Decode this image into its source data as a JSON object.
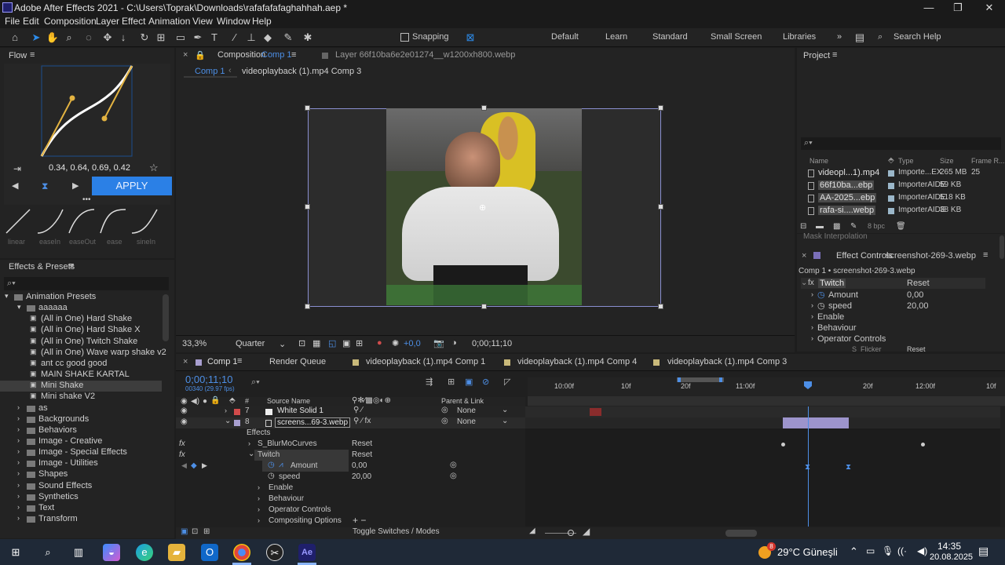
{
  "window": {
    "title": "Adobe After Effects 2021 - C:\\Users\\Toprak\\Downloads\\rafafafafaghahhah.aep *",
    "minimize": "—",
    "maximize": "❐",
    "close": "✕"
  },
  "menu": [
    "File",
    "Edit",
    "Composition",
    "Layer",
    "Effect",
    "Animation",
    "View",
    "Window",
    "Help"
  ],
  "toolbar": {
    "snapping": "Snapping",
    "workspaces": [
      "Default",
      "Learn",
      "Standard",
      "Small Screen",
      "Libraries"
    ],
    "more": "»",
    "search": "Search Help"
  },
  "flow": {
    "title": "Flow",
    "values": "0.34, 0.64, 0.69, 0.42",
    "apply": "APPLY",
    "presets": [
      "linear",
      "easeIn",
      "easeOut",
      "ease",
      "sineIn"
    ]
  },
  "effects_presets": {
    "title": "Effects & Presets",
    "search_placeholder": "⌕▾",
    "items": [
      {
        "label": "Animation Presets",
        "depth": 0,
        "type": "folder",
        "open": true
      },
      {
        "label": "aaaaaa",
        "depth": 1,
        "type": "folder",
        "open": true
      },
      {
        "label": "(All in One) Hard Shake",
        "depth": 2,
        "type": "preset"
      },
      {
        "label": "(All in One) Hard Shake X",
        "depth": 2,
        "type": "preset"
      },
      {
        "label": "(All in One) Twitch Shake",
        "depth": 2,
        "type": "preset"
      },
      {
        "label": "(All in One) Wave warp shake v2",
        "depth": 2,
        "type": "preset"
      },
      {
        "label": "ant cc good good",
        "depth": 2,
        "type": "preset"
      },
      {
        "label": "MAIN SHAKE KARTAL",
        "depth": 2,
        "type": "preset"
      },
      {
        "label": "Mini Shake",
        "depth": 2,
        "type": "preset",
        "selected": true
      },
      {
        "label": "Mini shake V2",
        "depth": 2,
        "type": "preset"
      },
      {
        "label": "as",
        "depth": 1,
        "type": "folder"
      },
      {
        "label": "Backgrounds",
        "depth": 1,
        "type": "folder"
      },
      {
        "label": "Behaviors",
        "depth": 1,
        "type": "folder"
      },
      {
        "label": "Image - Creative",
        "depth": 1,
        "type": "folder"
      },
      {
        "label": "Image - Special Effects",
        "depth": 1,
        "type": "folder"
      },
      {
        "label": "Image - Utilities",
        "depth": 1,
        "type": "folder"
      },
      {
        "label": "Shapes",
        "depth": 1,
        "type": "folder"
      },
      {
        "label": "Sound Effects",
        "depth": 1,
        "type": "folder"
      },
      {
        "label": "Synthetics",
        "depth": 1,
        "type": "folder"
      },
      {
        "label": "Text",
        "depth": 1,
        "type": "folder"
      },
      {
        "label": "Transform",
        "depth": 1,
        "type": "folder"
      }
    ]
  },
  "viewer": {
    "tab_comp": "Composition",
    "tab_comp_name": "Comp 1",
    "tab_layer": "Layer  66f10ba6e2e01274__w1200xh800.webp",
    "breadcrumb_1": "Comp 1",
    "breadcrumb_2": "videoplayback (1).mp4 Comp 3",
    "zoom": "33,3%",
    "resolution": "Quarter",
    "exposure": "+0,0",
    "timecode": "0;00;11;10"
  },
  "project": {
    "title": "Project",
    "search": "⌕▾",
    "columns": [
      "Name",
      "Type",
      "Size",
      "Frame R..."
    ],
    "rows": [
      {
        "name": "videopl...1).mp4",
        "type": "Importe...EX",
        "size": "265 MB",
        "fr": "25"
      },
      {
        "name": "66f10ba...ebp",
        "type": "ImporterAIDE",
        "size": "59 KB",
        "fr": ""
      },
      {
        "name": "AA-2025...ebp",
        "type": "ImporterAIDE",
        "size": "518 KB",
        "fr": ""
      },
      {
        "name": "rafa-si....webp",
        "type": "ImporterAIDE",
        "size": "38 KB",
        "fr": ""
      }
    ],
    "bpc": "8 bpc",
    "mask_interp": "Mask Interpolation"
  },
  "effect_controls": {
    "title": "Effect Controls",
    "layer": "screenshot-269-3.webp",
    "path": "Comp 1 • screenshot-269-3.webp",
    "effect": "Twitch",
    "reset": "Reset",
    "amount_label": "Amount",
    "amount": "0,00",
    "speed_label": "speed",
    "speed": "20,00",
    "groups": [
      "Enable",
      "Behaviour",
      "Operator Controls"
    ],
    "next": "S_Flicker"
  },
  "timeline": {
    "tabs": [
      "Comp 1",
      "Render Queue",
      "videoplayback (1).mp4 Comp 1",
      "videoplayback (1).mp4 Comp 4",
      "videoplayback (1).mp4 Comp 3"
    ],
    "timecode": "0;00;11;10",
    "sub_timecode": "00340 (29.97 fps)",
    "ruler": [
      "10:00f",
      "10f",
      "20f",
      "11:00f",
      "20f",
      "12:00f",
      "10f"
    ],
    "col_source": "Source Name",
    "col_parent": "Parent & Link",
    "col_num": "#",
    "layers": [
      {
        "num": "7",
        "name": "White Solid 1",
        "parent": "None",
        "color": "#d14b4b"
      },
      {
        "num": "8",
        "name": "screens...69-3.webp",
        "parent": "None",
        "color": "#a89fd0"
      }
    ],
    "props": {
      "effects": "Effects",
      "blur": "S_BlurMoCurves",
      "twitch": "Twitch",
      "reset": "Reset",
      "amount": "Amount",
      "amount_val": "0,00",
      "speed": "speed",
      "speed_val": "20,00",
      "enable": "Enable",
      "behaviour": "Behaviour",
      "operator": "Operator Controls",
      "compositing": "Compositing Options",
      "plusminus": "+ −"
    },
    "footer": "Toggle Switches / Modes"
  },
  "taskbar": {
    "weather": "29°C Güneşli",
    "time": "14:35",
    "date": "20.08.2025",
    "weather_badge": "8"
  },
  "colors": {
    "accent": "#2d8ceb",
    "ae_blue": "#4d8fe6",
    "apply_bg": "#2b80e6"
  }
}
